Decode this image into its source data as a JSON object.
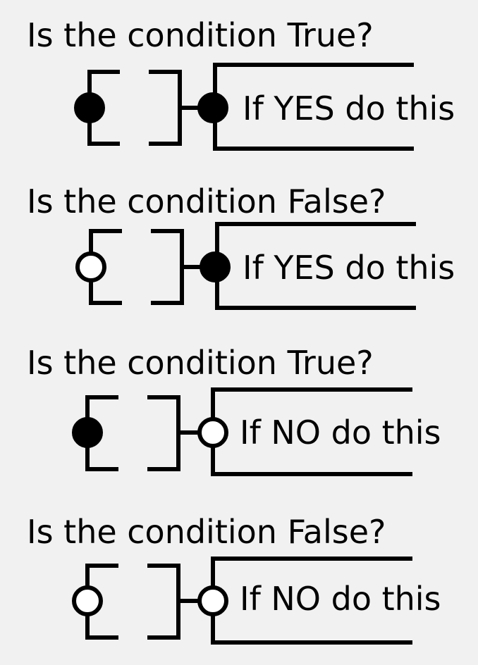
{
  "colors": {
    "background": "#f1f1f1",
    "line": "#000000",
    "dot_filled": "#000000",
    "dot_open": "#ffffff"
  },
  "blocks": [
    {
      "question": "Is the condition True?",
      "condition_dot": "filled",
      "branch_dot": "filled",
      "action": "If YES do this"
    },
    {
      "question": "Is the condition False?",
      "condition_dot": "open",
      "branch_dot": "filled",
      "action": "If YES do this"
    },
    {
      "question": "Is the condition True?",
      "condition_dot": "filled",
      "branch_dot": "open",
      "action": "If NO do this"
    },
    {
      "question": "Is the condition False?",
      "condition_dot": "open",
      "branch_dot": "open",
      "action": "If NO do this"
    }
  ]
}
